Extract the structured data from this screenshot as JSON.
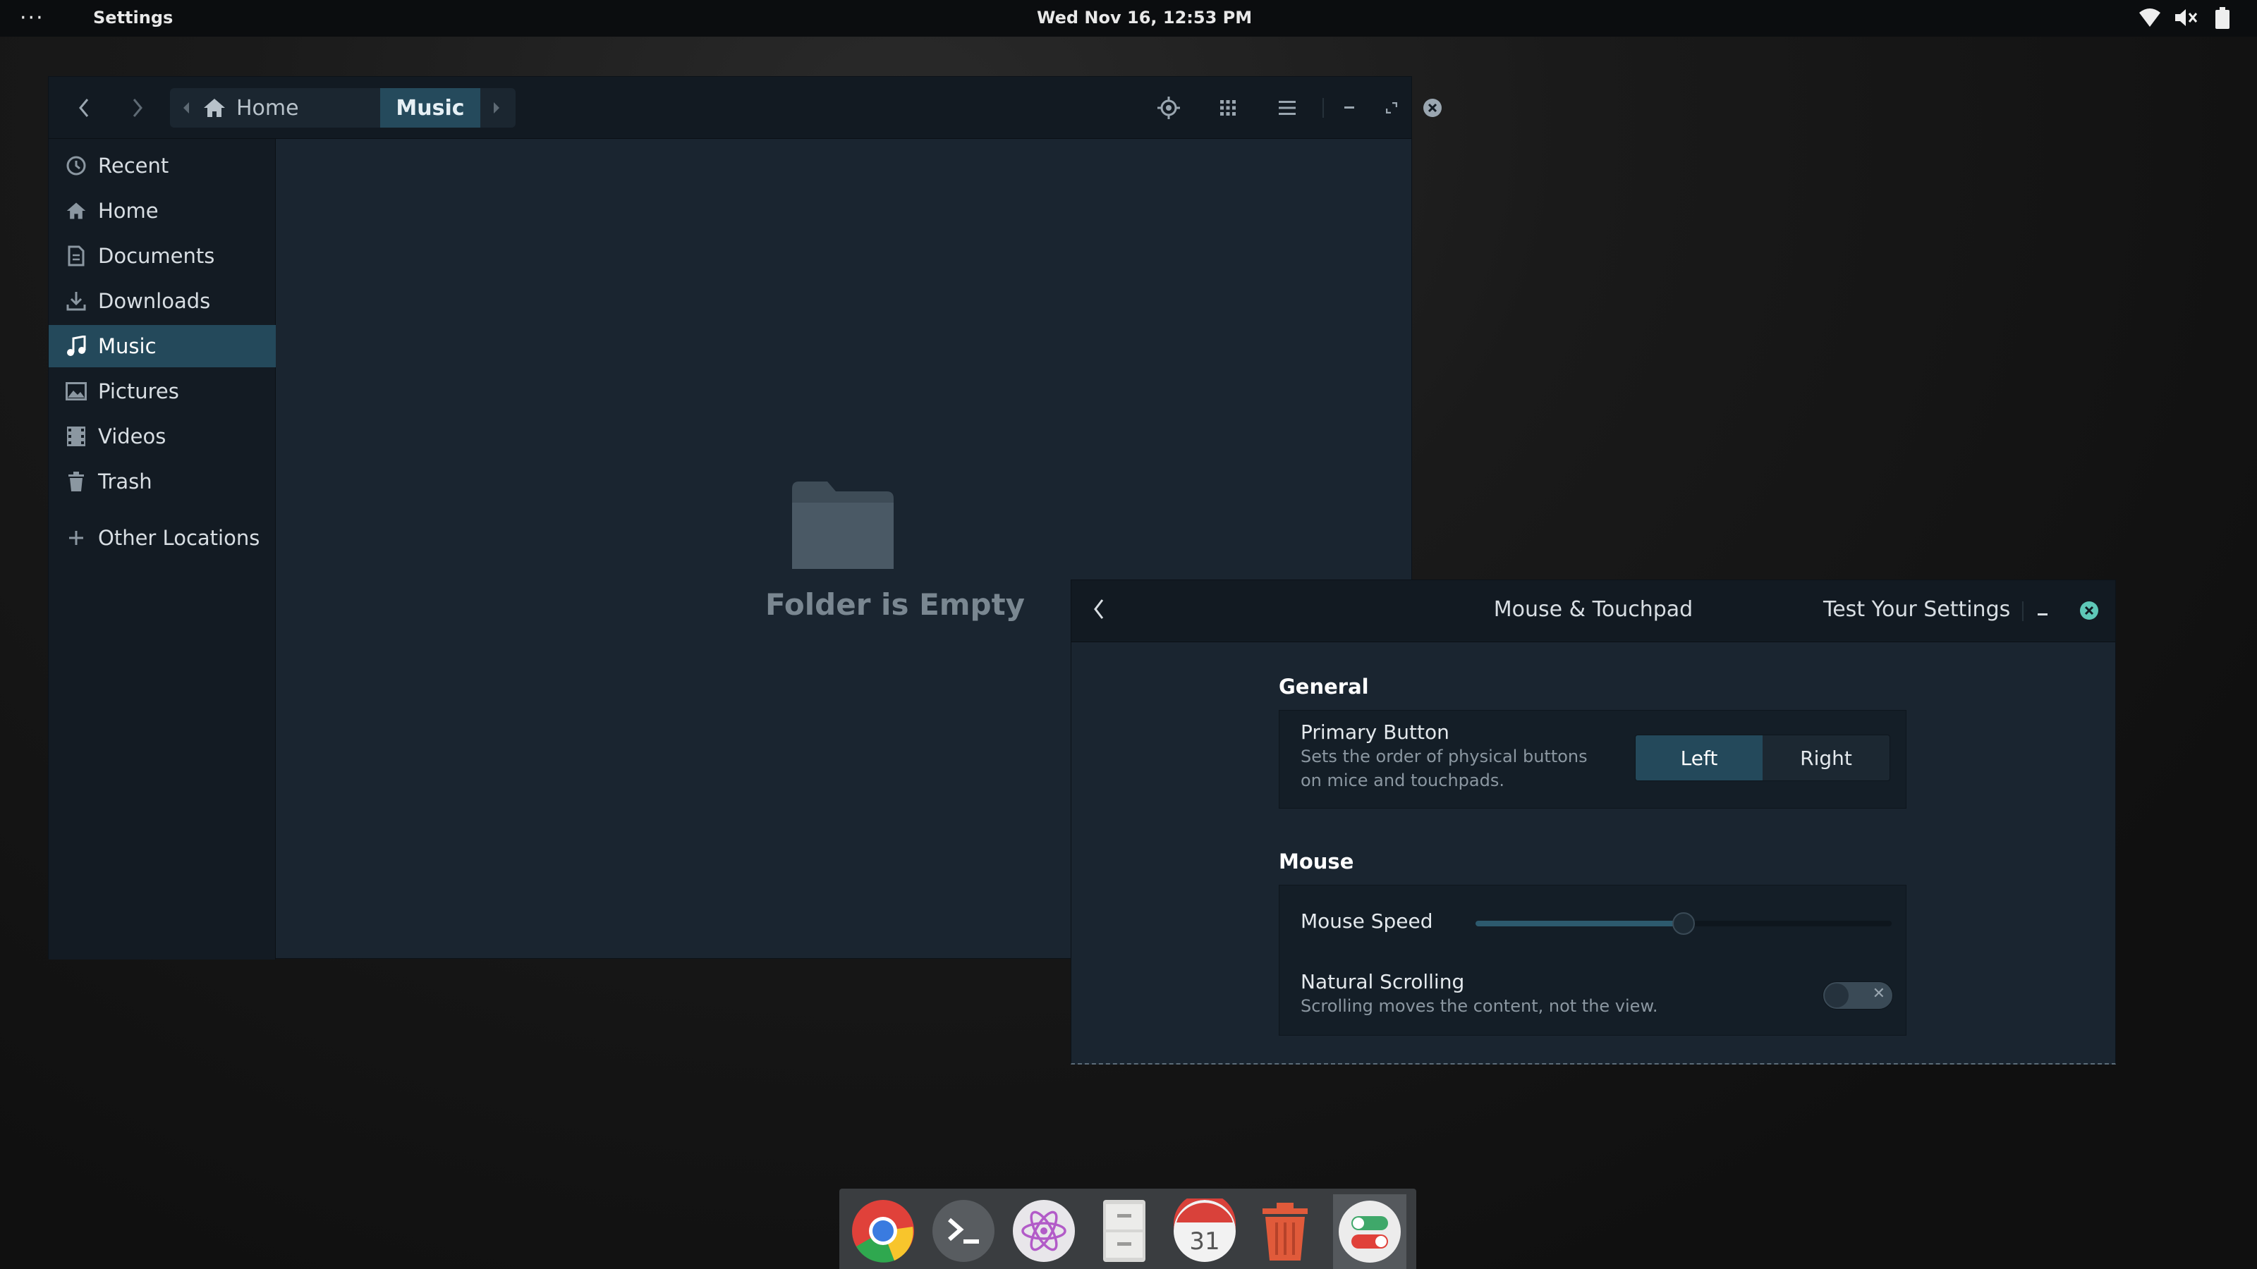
{
  "topbar": {
    "menu_glyph": "···",
    "app_name": "Settings",
    "clock": "Wed Nov 16, 12:53 PM",
    "tray_icons": [
      "wifi-icon",
      "volume-muted-icon",
      "battery-icon"
    ]
  },
  "files_window": {
    "breadcrumbs": [
      "Home",
      "Music"
    ],
    "sidebar": [
      {
        "label": "Recent",
        "icon": "clock-icon"
      },
      {
        "label": "Home",
        "icon": "home-icon"
      },
      {
        "label": "Documents",
        "icon": "document-icon"
      },
      {
        "label": "Downloads",
        "icon": "download-icon"
      },
      {
        "label": "Music",
        "icon": "music-icon",
        "active": true
      },
      {
        "label": "Pictures",
        "icon": "image-icon"
      },
      {
        "label": "Videos",
        "icon": "film-icon"
      },
      {
        "label": "Trash",
        "icon": "trash-icon"
      },
      {
        "label": "Other Locations",
        "icon": "plus-icon"
      }
    ],
    "empty_message": "Folder is Empty"
  },
  "settings_window": {
    "title": "Mouse & Touchpad",
    "test_button": "Test Your Settings",
    "general_header": "General",
    "primary_button": {
      "title": "Primary Button",
      "description_line1": "Sets the order of physical buttons",
      "description_line2": "on mice and touchpads.",
      "options": [
        "Left",
        "Right"
      ],
      "selected": "Left"
    },
    "mouse_header": "Mouse",
    "mouse_speed": {
      "label": "Mouse Speed",
      "value_fraction": 0.5
    },
    "natural_scrolling": {
      "title": "Natural Scrolling",
      "description": "Scrolling moves the content, not the view.",
      "enabled": false
    }
  },
  "dock": {
    "items": [
      "chrome-icon",
      "terminal-icon",
      "atom-icon",
      "files-icon",
      "calendar-icon",
      "trash-icon",
      "settings-toggle-icon"
    ],
    "calendar_day": "31"
  },
  "colors": {
    "accent": "#24495b",
    "window_bg": "#1a2530",
    "headerbar_bg": "#121a22",
    "close_button": "#5ec8b8"
  }
}
